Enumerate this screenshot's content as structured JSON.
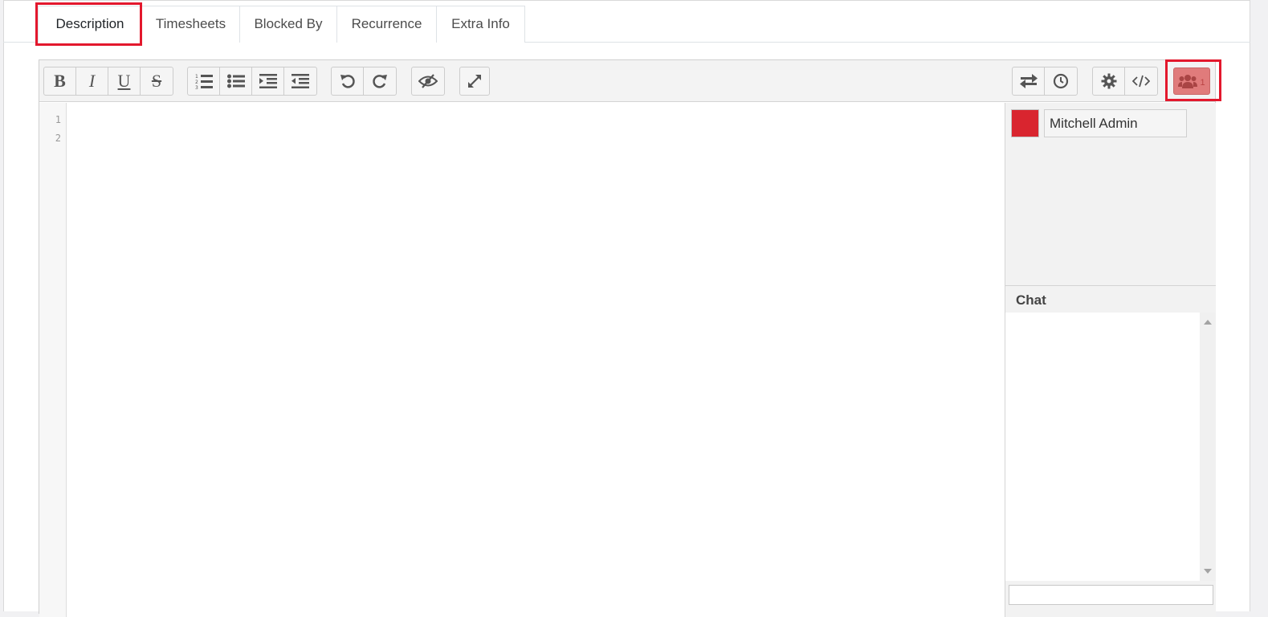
{
  "tabs": [
    {
      "label": "Description",
      "active": true
    },
    {
      "label": "Timesheets",
      "active": false
    },
    {
      "label": "Blocked By",
      "active": false
    },
    {
      "label": "Recurrence",
      "active": false
    },
    {
      "label": "Extra Info",
      "active": false
    }
  ],
  "toolbar": {
    "bold_label": "B",
    "italic_label": "I",
    "underline_label": "U",
    "strike_label": "S",
    "icons": [
      "ordered-list-icon",
      "unordered-list-icon",
      "indent-icon",
      "outdent-icon",
      "undo-icon",
      "redo-icon",
      "eye-slash-icon",
      "expand-icon",
      "swap-icon",
      "clock-icon",
      "gear-icon",
      "code-icon",
      "users-icon"
    ],
    "users_count": "1",
    "users_button_color": "#e07b7b"
  },
  "editor": {
    "line_numbers": [
      "1",
      "2"
    ]
  },
  "side_panel": {
    "user_name": "Mitchell Admin",
    "user_color": "#d9252f",
    "chat_title": "Chat",
    "chat_input_value": ""
  },
  "highlight_color": "#e3182d"
}
